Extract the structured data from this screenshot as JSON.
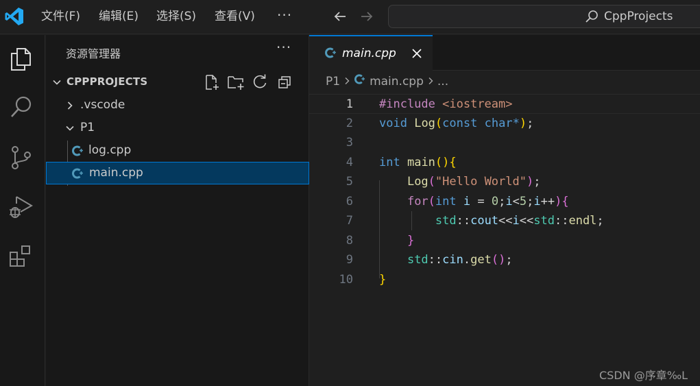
{
  "titlebar": {
    "menu": [
      {
        "label": "文件(F)"
      },
      {
        "label": "编辑(E)"
      },
      {
        "label": "选择(S)"
      },
      {
        "label": "查看(V)"
      }
    ],
    "more": "···",
    "search_text": "CppProjects"
  },
  "sidebar": {
    "title": "资源管理器",
    "more": "···",
    "workspace": "CPPPROJECTS",
    "tree": [
      {
        "label": ".vscode",
        "type": "folder",
        "expanded": false
      },
      {
        "label": "P1",
        "type": "folder",
        "expanded": true
      },
      {
        "label": "log.cpp",
        "type": "file"
      },
      {
        "label": "main.cpp",
        "type": "file",
        "selected": true
      }
    ]
  },
  "editor": {
    "tab": {
      "label": "main.cpp",
      "icon": "cpp-file-icon"
    },
    "breadcrumb": [
      "P1",
      "main.cpp",
      "..."
    ],
    "active_line": 1,
    "lines": [
      {
        "n": "1",
        "tokens": [
          {
            "t": "#include",
            "c": "c-ctrl"
          },
          {
            "t": " ",
            "c": ""
          },
          {
            "t": "<iostream>",
            "c": "c-str"
          }
        ]
      },
      {
        "n": "2",
        "tokens": [
          {
            "t": "void",
            "c": "c-kw"
          },
          {
            "t": " ",
            "c": ""
          },
          {
            "t": "Log",
            "c": "c-fn"
          },
          {
            "t": "(",
            "c": "c-b1"
          },
          {
            "t": "const",
            "c": "c-kw"
          },
          {
            "t": " ",
            "c": ""
          },
          {
            "t": "char",
            "c": "c-kw"
          },
          {
            "t": "*",
            "c": "c-kw"
          },
          {
            "t": ")",
            "c": "c-b1"
          },
          {
            "t": ";",
            "c": ""
          }
        ]
      },
      {
        "n": "3",
        "tokens": []
      },
      {
        "n": "4",
        "tokens": [
          {
            "t": "int",
            "c": "c-kw"
          },
          {
            "t": " ",
            "c": ""
          },
          {
            "t": "main",
            "c": "c-fn"
          },
          {
            "t": "()",
            "c": "c-b1"
          },
          {
            "t": "{",
            "c": "c-b1"
          }
        ]
      },
      {
        "n": "5",
        "tokens": [
          {
            "t": "    ",
            "c": ""
          },
          {
            "t": "Log",
            "c": "c-fn"
          },
          {
            "t": "(",
            "c": "c-b2"
          },
          {
            "t": "\"Hello World\"",
            "c": "c-str"
          },
          {
            "t": ")",
            "c": "c-b2"
          },
          {
            "t": ";",
            "c": ""
          }
        ]
      },
      {
        "n": "6",
        "tokens": [
          {
            "t": "    ",
            "c": ""
          },
          {
            "t": "for",
            "c": "c-ctrl"
          },
          {
            "t": "(",
            "c": "c-b2"
          },
          {
            "t": "int",
            "c": "c-kw"
          },
          {
            "t": " ",
            "c": ""
          },
          {
            "t": "i",
            "c": "c-var"
          },
          {
            "t": " = ",
            "c": ""
          },
          {
            "t": "0",
            "c": "c-num"
          },
          {
            "t": ";",
            "c": ""
          },
          {
            "t": "i",
            "c": "c-var"
          },
          {
            "t": "<",
            "c": ""
          },
          {
            "t": "5",
            "c": "c-num"
          },
          {
            "t": ";",
            "c": ""
          },
          {
            "t": "i",
            "c": "c-var"
          },
          {
            "t": "++",
            "c": ""
          },
          {
            "t": ")",
            "c": "c-b2"
          },
          {
            "t": "{",
            "c": "c-b2"
          }
        ]
      },
      {
        "n": "7",
        "tokens": [
          {
            "t": "        ",
            "c": ""
          },
          {
            "t": "std",
            "c": "c-ns"
          },
          {
            "t": "::",
            "c": ""
          },
          {
            "t": "cout",
            "c": "c-var"
          },
          {
            "t": "<<",
            "c": ""
          },
          {
            "t": "i",
            "c": "c-var"
          },
          {
            "t": "<<",
            "c": ""
          },
          {
            "t": "std",
            "c": "c-ns"
          },
          {
            "t": "::",
            "c": ""
          },
          {
            "t": "endl",
            "c": "c-fn"
          },
          {
            "t": ";",
            "c": ""
          }
        ]
      },
      {
        "n": "8",
        "tokens": [
          {
            "t": "    ",
            "c": ""
          },
          {
            "t": "}",
            "c": "c-b2"
          }
        ]
      },
      {
        "n": "9",
        "tokens": [
          {
            "t": "    ",
            "c": ""
          },
          {
            "t": "std",
            "c": "c-ns"
          },
          {
            "t": "::",
            "c": ""
          },
          {
            "t": "cin",
            "c": "c-var"
          },
          {
            "t": ".",
            "c": ""
          },
          {
            "t": "get",
            "c": "c-fn"
          },
          {
            "t": "()",
            "c": "c-b2"
          },
          {
            "t": ";",
            "c": ""
          }
        ]
      },
      {
        "n": "10",
        "tokens": [
          {
            "t": "}",
            "c": "c-b1"
          }
        ]
      }
    ]
  },
  "watermark": "CSDN @序章‰L",
  "colors": {
    "accent": "#0078d4",
    "selection": "#04395e",
    "vscode_blue": "#23a9f2",
    "cpp_icon": "#519aba"
  }
}
